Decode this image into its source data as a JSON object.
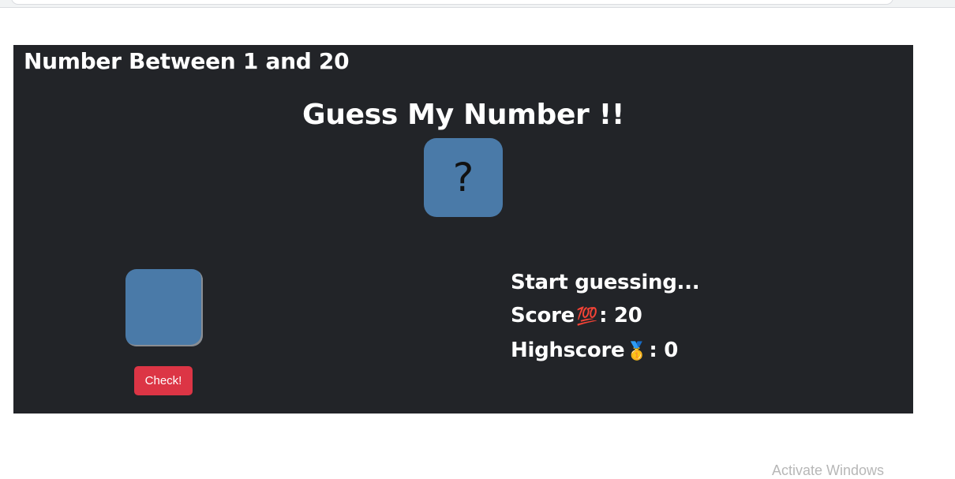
{
  "page": {
    "range_label": "Number Between 1 and 20",
    "title": "Guess My Number !!",
    "secret_display": "?",
    "guess_input_value": "",
    "check_button_label": "Check!",
    "message": "Start guessing...",
    "score_label": "Score",
    "score_emoji": "💯",
    "score_separator": ": ",
    "score_value": "20",
    "highscore_label": "Highscore",
    "highscore_emoji": "🥇",
    "highscore_separator": ": ",
    "highscore_value": "0"
  },
  "os_overlay": {
    "watermark_text": "Activate Windows"
  },
  "colors": {
    "panel_bg": "#222428",
    "box_blue": "#4a7aa8",
    "check_red": "#dc3545",
    "text_white": "#ffffff"
  }
}
